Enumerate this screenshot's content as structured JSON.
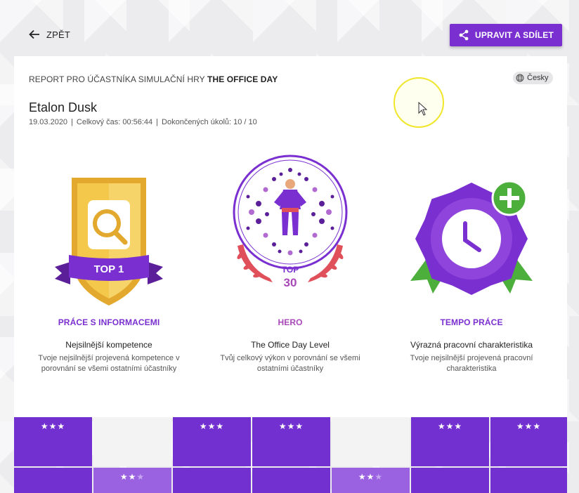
{
  "header": {
    "back_label": "ZPĚT",
    "share_label": "UPRAVIT A SDÍLET"
  },
  "report": {
    "prefix": "REPORT PRO ÚČASTNÍKA SIMULAČNÍ HRY ",
    "game_name": "THE OFFICE DAY",
    "language": "Česky",
    "participant_name": "Etalon Dusk",
    "date": "19.03.2020",
    "total_time": "Celkový čas: 00:56:44",
    "tasks_done": "Dokončených úkolů: 10 / 10"
  },
  "badges": [
    {
      "ribbon_text": "TOP 1",
      "title": "PRÁCE S INFORMACEMI",
      "subtitle": "Nejsilnější kompetence",
      "description": "Tvoje nejsilnější projevená kompetence v porovnání se všemi ostatními účastníky"
    },
    {
      "rank_top": "TOP",
      "rank_num": "30",
      "title": "HERO",
      "subtitle": "The Office Day Level",
      "description": "Tvůj celkový výkon v porovnání se všemi ostatními účastníky"
    },
    {
      "title": "TEMPO PRÁCE",
      "subtitle": "Výrazná pracovní charakteristika",
      "description": "Tvoje nejsilnější projevená pracovní charakteristika"
    }
  ],
  "grid": {
    "row1": [
      {
        "stars": "★★★",
        "dim": ""
      },
      {
        "stars": "",
        "dim": ""
      },
      {
        "stars": "★★★",
        "dim": ""
      },
      {
        "stars": "★★★",
        "dim": ""
      },
      {
        "stars": "",
        "dim": ""
      },
      {
        "stars": "★★★",
        "dim": ""
      },
      {
        "stars": "★★★",
        "dim": ""
      }
    ],
    "row2": [
      {
        "stars": "",
        "dim": ""
      },
      {
        "stars": "★★",
        "dim": "★"
      },
      {
        "stars": "",
        "dim": ""
      },
      {
        "stars": "",
        "dim": ""
      },
      {
        "stars": "★★",
        "dim": "★"
      },
      {
        "stars": "",
        "dim": ""
      },
      {
        "stars": "",
        "dim": ""
      }
    ]
  },
  "colors": {
    "accent": "#7a2fd0",
    "gold": "#f2c54a",
    "hero_pink": "#a948b8",
    "laurel_red": "#e0505a",
    "green": "#4caf3c"
  }
}
